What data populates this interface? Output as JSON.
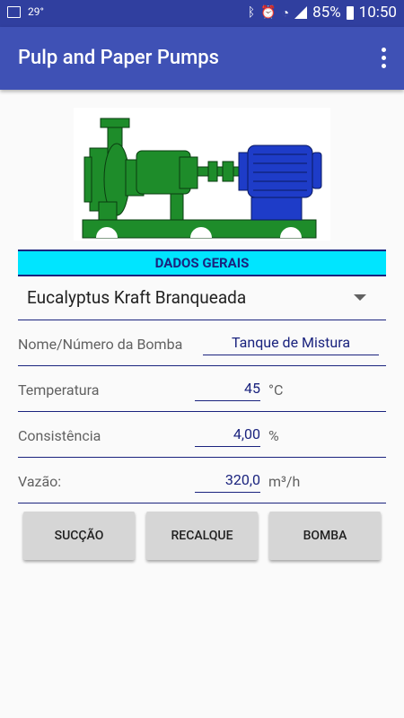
{
  "status_bar": {
    "temperature": "29°",
    "battery": "85%",
    "time": "10:50"
  },
  "app_bar": {
    "title": "Pulp and Paper Pumps"
  },
  "section": {
    "header": "DADOS GERAIS"
  },
  "pulp_type": {
    "selected": "Eucalyptus Kraft Branqueada"
  },
  "fields": {
    "pump_name": {
      "label": "Nome/Número da Bomba",
      "value": "Tanque de Mistura"
    },
    "temperature": {
      "label": "Temperatura",
      "value": "45",
      "unit": "°C"
    },
    "consistency": {
      "label": "Consistência",
      "value": "4,00",
      "unit": "%"
    },
    "flow": {
      "label": "Vazão:",
      "value": "320,0",
      "unit": "m³/h"
    }
  },
  "buttons": {
    "suction": "SUCÇÃO",
    "discharge": "RECALQUE",
    "pump": "BOMBA"
  },
  "colors": {
    "status_bar": "#303f9f",
    "app_bar": "#3f51b5",
    "section_header": "#00e5ff",
    "divider": "#1a237e",
    "pump_green": "#1e8c2a",
    "motor_blue": "#1e3cc8"
  }
}
